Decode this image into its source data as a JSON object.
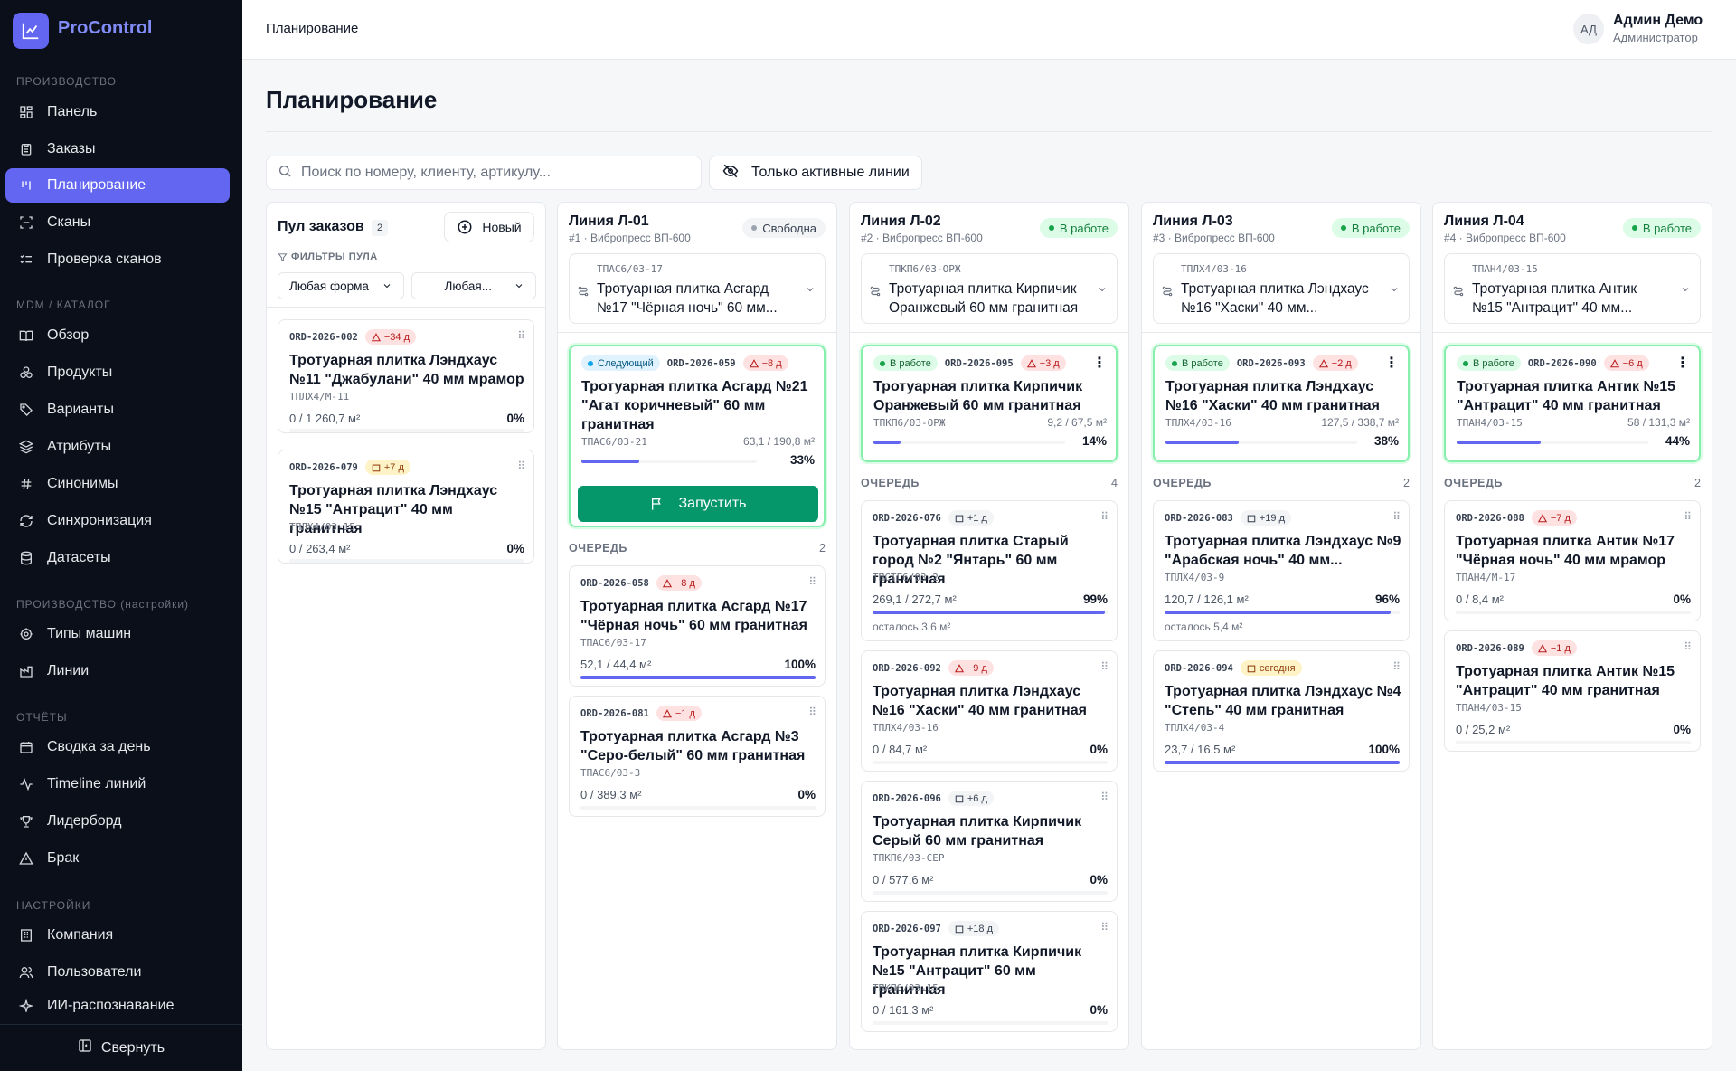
{
  "app": {
    "brand": "ProControl",
    "collapse_label": "Свернуть"
  },
  "sidebar": {
    "sections": [
      {
        "title": "ПРОИЗВОДСТВО"
      },
      {
        "title": "MDM / КАТАЛОГ"
      },
      {
        "title": "ПРОИЗВОДСТВО (настройки)"
      },
      {
        "title": "ОТЧЁТЫ"
      },
      {
        "title": "НАСТРОЙКИ"
      }
    ],
    "items": [
      {
        "label": "Панель",
        "icon": "dashboard-icon"
      },
      {
        "label": "Заказы",
        "icon": "clipboard-icon"
      },
      {
        "label": "Планирование",
        "icon": "kanban-icon"
      },
      {
        "label": "Сканы",
        "icon": "scan-icon"
      },
      {
        "label": "Проверка сканов",
        "icon": "list-check-icon"
      },
      {
        "label": "Обзор",
        "icon": "book-icon"
      },
      {
        "label": "Продукты",
        "icon": "boxes-icon"
      },
      {
        "label": "Варианты",
        "icon": "tags-icon"
      },
      {
        "label": "Атрибуты",
        "icon": "layers-icon"
      },
      {
        "label": "Синонимы",
        "icon": "hash-icon"
      },
      {
        "label": "Синхронизация",
        "icon": "sync-icon"
      },
      {
        "label": "Датасеты",
        "icon": "database-icon"
      },
      {
        "label": "Типы машин",
        "icon": "cog-icon"
      },
      {
        "label": "Линии",
        "icon": "factory-icon"
      },
      {
        "label": "Сводка за день",
        "icon": "calendar-icon"
      },
      {
        "label": "Timeline линий",
        "icon": "activity-icon"
      },
      {
        "label": "Лидерборд",
        "icon": "trophy-icon"
      },
      {
        "label": "Брак",
        "icon": "warning-icon"
      },
      {
        "label": "Компания",
        "icon": "building-icon"
      },
      {
        "label": "Пользователи",
        "icon": "users-icon"
      },
      {
        "label": "ИИ-распознавание",
        "icon": "sparkle-icon"
      }
    ]
  },
  "header": {
    "breadcrumb": "Планирование",
    "avatar": "АД",
    "user_name": "Админ Демо",
    "user_role": "Администратор"
  },
  "page": {
    "title": "Планирование",
    "search_placeholder": "Поиск по номеру, клиенту, артикулу...",
    "only_active_label": "Только активные линии"
  },
  "pool": {
    "title": "Пул заказов",
    "count": "2",
    "new_label": "Новый",
    "filters_label": "ФИЛЬТРЫ ПУЛА",
    "filter_shape": "Любая форма",
    "filter_other": "Любая...",
    "cards": [
      {
        "code": "ORD-2026-002",
        "tag": "−34 д",
        "title": "Тротуарная плитка Лэндхаус №11 \"Джабулани\" 40 мм мрамор",
        "sku": "ТПЛХ4/М-11",
        "qty": "0 / 1 260,7 м²",
        "pct": "0%"
      },
      {
        "code": "ORD-2026-079",
        "tag": "+7 д",
        "title": "Тротуарная плитка Лэндхаус №15 \"Антрацит\" 40 мм гранитная",
        "sku": "ТПЛХ4/03-15",
        "qty": "0 / 263,4 м²",
        "pct": "0%"
      }
    ]
  },
  "lines": [
    {
      "title": "Линия Л-01",
      "subtitle": "#1 · Вибропресс ВП-600",
      "status": "Свободна",
      "sel_code": "ТПАС6/03-17",
      "sel_text": "Тротуарная плитка Асгард №17 \"Чёрная ночь\" 60 мм...",
      "active": {
        "state": "Следующий",
        "code": "ORD-2026-059",
        "tag": "−8 д",
        "title": "Тротуарная плитка Асгард №21 \"Агат коричневый\" 60 мм гранитная",
        "sku": "ТПАС6/03-21",
        "ratio": "63,1 / 190,8 м²",
        "pct": "33%",
        "progress": 0.33
      },
      "start_label": "Запустить",
      "queue_label": "ОЧЕРЕДЬ",
      "queue_count": "2",
      "queue": [
        {
          "code": "ORD-2026-058",
          "tag": "−8 д",
          "title": "Тротуарная плитка Асгард №17 \"Чёрная ночь\" 60 мм гранитная",
          "sku": "ТПАС6/03-17",
          "qty": "52,1 / 44,4 м²",
          "pct": "100%",
          "progress": 1.0
        },
        {
          "code": "ORD-2026-081",
          "tag": "−1 д",
          "title": "Тротуарная плитка Асгард №3 \"Серо-белый\" 60 мм гранитная",
          "sku": "ТПАС6/03-3",
          "qty": "0 / 389,3 м²",
          "pct": "0%",
          "progress": 0
        }
      ]
    },
    {
      "title": "Линия Л-02",
      "subtitle": "#2 · Вибропресс ВП-600",
      "status": "В работе",
      "sel_code": "ТПКП6/03-ОРЖ",
      "sel_text": "Тротуарная плитка Кирпичик Оранжевый 60 мм гранитная",
      "active": {
        "state": "В работе",
        "code": "ORD-2026-095",
        "tag": "−3 д",
        "title": "Тротуарная плитка Кирпичик Оранжевый 60 мм гранитная",
        "sku": "ТПКП6/03-ОРЖ",
        "ratio": "9,2 / 67,5 м²",
        "pct": "14%",
        "progress": 0.14
      },
      "queue_label": "ОЧЕРЕДЬ",
      "queue_count": "4",
      "queue": [
        {
          "code": "ORD-2026-076",
          "tag": "+1 д",
          "title": "Тротуарная плитка Старый город №2 \"Янтарь\" 60 мм гранитная",
          "sku": "ТПСТГ6/03-2",
          "qty": "269,1 / 272,7 м²",
          "pct": "99%",
          "progress": 0.99,
          "remain": "осталось 3,6 м²"
        },
        {
          "code": "ORD-2026-092",
          "tag": "−9 д",
          "title": "Тротуарная плитка Лэндхаус №16 \"Хаски\" 40 мм гранитная",
          "sku": "ТПЛХ4/03-16",
          "qty": "0 / 84,7 м²",
          "pct": "0%",
          "progress": 0
        },
        {
          "code": "ORD-2026-096",
          "tag": "+6 д",
          "title": "Тротуарная плитка Кирпичик Серый 60 мм гранитная",
          "sku": "ТПКП6/03-СЕР",
          "qty": "0 / 577,6 м²",
          "pct": "0%",
          "progress": 0
        },
        {
          "code": "ORD-2026-097",
          "tag": "+18 д",
          "title": "Тротуарная плитка Кирпичик №15 \"Антрацит\" 60 мм гранитная",
          "sku": "ТПКП6/03-15",
          "qty": "0 / 161,3 м²",
          "pct": "0%",
          "progress": 0
        }
      ]
    },
    {
      "title": "Линия Л-03",
      "subtitle": "#3 · Вибропресс ВП-600",
      "status": "В работе",
      "sel_code": "ТПЛХ4/03-16",
      "sel_text": "Тротуарная плитка Лэндхаус №16 \"Хаски\" 40 мм...",
      "active": {
        "state": "В работе",
        "code": "ORD-2026-093",
        "tag": "−2 д",
        "title": "Тротуарная плитка Лэндхаус №16 \"Хаски\" 40 мм гранитная",
        "sku": "ТПЛХ4/03-16",
        "ratio": "127,5 / 338,7 м²",
        "pct": "38%",
        "progress": 0.38
      },
      "queue_label": "ОЧЕРЕДЬ",
      "queue_count": "2",
      "queue": [
        {
          "code": "ORD-2026-083",
          "tag": "+19 д",
          "title": "Тротуарная плитка Лэндхаус №9 \"Арабская ночь\" 40 мм...",
          "sku": "ТПЛХ4/03-9",
          "qty": "120,7 / 126,1 м²",
          "pct": "96%",
          "progress": 0.96,
          "remain": "осталось 5,4 м²"
        },
        {
          "code": "ORD-2026-094",
          "tag": "сегодня",
          "title": "Тротуарная плитка Лэндхаус №4 \"Степь\" 40 мм гранитная",
          "sku": "ТПЛХ4/03-4",
          "qty": "23,7 / 16,5 м²",
          "pct": "100%",
          "progress": 1.0
        }
      ]
    },
    {
      "title": "Линия Л-04",
      "subtitle": "#4 · Вибропресс ВП-600",
      "status": "В работе",
      "sel_code": "ТПАН4/03-15",
      "sel_text": "Тротуарная плитка Антик №15 \"Антрацит\" 40 мм...",
      "active": {
        "state": "В работе",
        "code": "ORD-2026-090",
        "tag": "−6 д",
        "title": "Тротуарная плитка Антик №15 \"Антрацит\" 40 мм гранитная",
        "sku": "ТПАН4/03-15",
        "ratio": "58 / 131,3 м²",
        "pct": "44%",
        "progress": 0.44
      },
      "queue_label": "ОЧЕРЕДЬ",
      "queue_count": "2",
      "queue": [
        {
          "code": "ORD-2026-088",
          "tag": "−7 д",
          "title": "Тротуарная плитка Антик №17 \"Чёрная ночь\" 40 мм мрамор",
          "sku": "ТПАН4/М-17",
          "qty": "0 / 8,4 м²",
          "pct": "0%",
          "progress": 0
        },
        {
          "code": "ORD-2026-089",
          "tag": "−1 д",
          "title": "Тротуарная плитка Антик №15 \"Антрацит\" 40 мм гранитная",
          "sku": "ТПАН4/03-15",
          "qty": "0 / 25,2 м²",
          "pct": "0%",
          "progress": 0
        }
      ]
    }
  ],
  "colors": {
    "accent": "#6366f1",
    "success": "#059669",
    "sidebar": "#0b0f19"
  }
}
